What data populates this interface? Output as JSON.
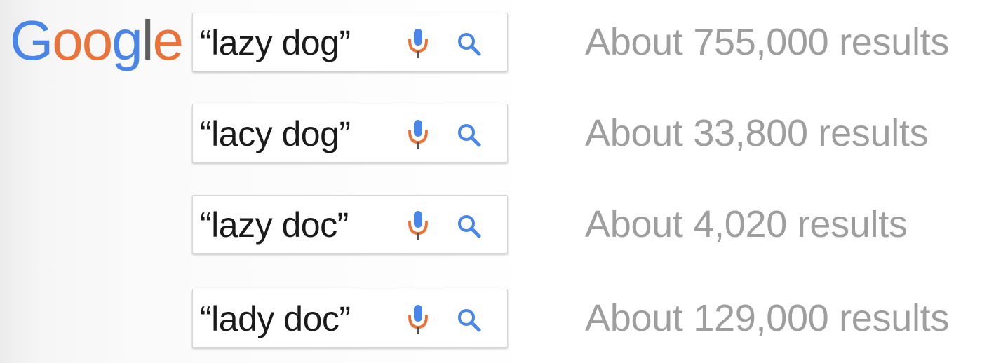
{
  "logo": {
    "letters": [
      "G",
      "o",
      "o",
      "g",
      "l",
      "e"
    ],
    "letter_colors": [
      "#4a86e8",
      "#e8743b",
      "#e8743b",
      "#4a86e8",
      "#5f5f5f",
      "#e8743b"
    ]
  },
  "colors": {
    "mic": "#e8743b",
    "mic_top": "#4a86e8",
    "search_icon": "#4a86e8",
    "result_text": "#9e9e9e"
  },
  "searches": [
    {
      "query": "“lazy dog”",
      "results": "About 755,000 results"
    },
    {
      "query": "“lacy dog”",
      "results": "About 33,800 results"
    },
    {
      "query": "“lazy doc”",
      "results": "About 4,020 results"
    },
    {
      "query": "“lady doc”",
      "results": "About 129,000 results"
    }
  ],
  "icons": {
    "mic": "microphone-icon",
    "search": "magnifier-icon"
  }
}
